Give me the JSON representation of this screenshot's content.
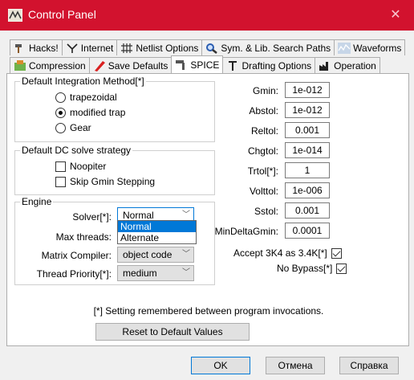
{
  "window": {
    "title": "Control Panel",
    "close_glyph": "✕"
  },
  "tabs_row1": [
    {
      "label": "Hacks!",
      "icon": "hammer-icon"
    },
    {
      "label": "Internet",
      "icon": "antenna-icon"
    },
    {
      "label": "Netlist Options",
      "icon": "netlist-grid-icon"
    },
    {
      "label": "Sym. & Lib. Search Paths",
      "icon": "magnifier-icon"
    },
    {
      "label": "Waveforms",
      "icon": "waveform-icon"
    }
  ],
  "tabs_row2": [
    {
      "label": "Compression",
      "icon": "compression-icon"
    },
    {
      "label": "Save Defaults",
      "icon": "pen-icon"
    },
    {
      "label": "SPICE",
      "icon": "spice-tool-icon",
      "active": true
    },
    {
      "label": "Drafting Options",
      "icon": "pin-icon"
    },
    {
      "label": "Operation",
      "icon": "factory-icon"
    }
  ],
  "integration": {
    "title": "Default Integration Method[*]",
    "options": [
      "trapezoidal",
      "modified trap",
      "Gear"
    ],
    "selected": "modified trap"
  },
  "dc_solve": {
    "title": "Default DC solve strategy",
    "noopiter": "Noopiter",
    "skip_gmin": "Skip Gmin Stepping"
  },
  "engine": {
    "title": "Engine",
    "solver_label": "Solver[*]:",
    "solver_value": "Normal",
    "solver_options": [
      "Normal",
      "Alternate"
    ],
    "max_threads_label": "Max threads:",
    "matrix_label": "Matrix Compiler:",
    "matrix_value": "object code",
    "priority_label": "Thread Priority[*]:",
    "priority_value": "medium"
  },
  "params": [
    {
      "label": "Gmin:",
      "value": "1e-012"
    },
    {
      "label": "Abstol:",
      "value": "1e-012"
    },
    {
      "label": "Reltol:",
      "value": "0.001"
    },
    {
      "label": "Chgtol:",
      "value": "1e-014"
    },
    {
      "label": "Trtol[*]:",
      "value": "1"
    },
    {
      "label": "Volttol:",
      "value": "1e-006"
    },
    {
      "label": "Sstol:",
      "value": "0.001"
    },
    {
      "label": "MinDeltaGmin:",
      "value": "0.0001"
    }
  ],
  "accept_3k4": "Accept 3K4 as 3.4K[*]",
  "no_bypass": "No Bypass[*]",
  "note": "[*] Setting remembered between program invocations.",
  "reset_button": "Reset to Default Values",
  "buttons": {
    "ok": "OK",
    "cancel": "Отмена",
    "help": "Справка"
  },
  "colors": {
    "titlebar": "#d2122e",
    "accent": "#0078d7"
  }
}
